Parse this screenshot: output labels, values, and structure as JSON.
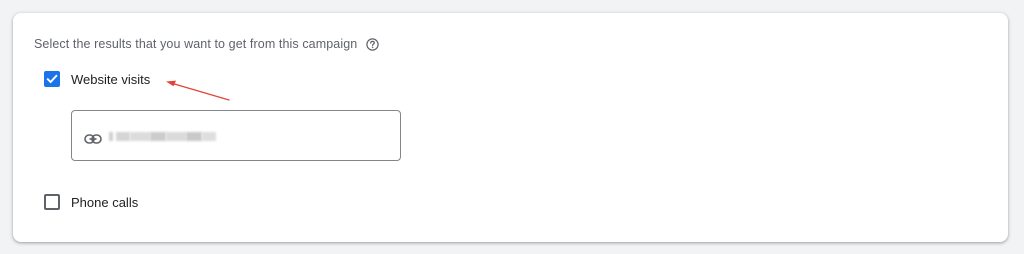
{
  "form": {
    "prompt": "Select the results that you want to get from this campaign",
    "help_icon": "help-circle-icon",
    "options": [
      {
        "label": "Website visits",
        "checked": true
      },
      {
        "label": "Phone calls",
        "checked": false
      }
    ],
    "website_url": {
      "value": "",
      "icon": "link-icon",
      "obscured": true
    }
  },
  "colors": {
    "page_bg": "#f1f3f4",
    "card_bg": "#ffffff",
    "checkbox_checked": "#1a73e8",
    "checkbox_unchecked_border": "#5f6368",
    "arrow": "#e0453a",
    "text_primary": "#202124",
    "text_secondary": "#5f6368"
  }
}
